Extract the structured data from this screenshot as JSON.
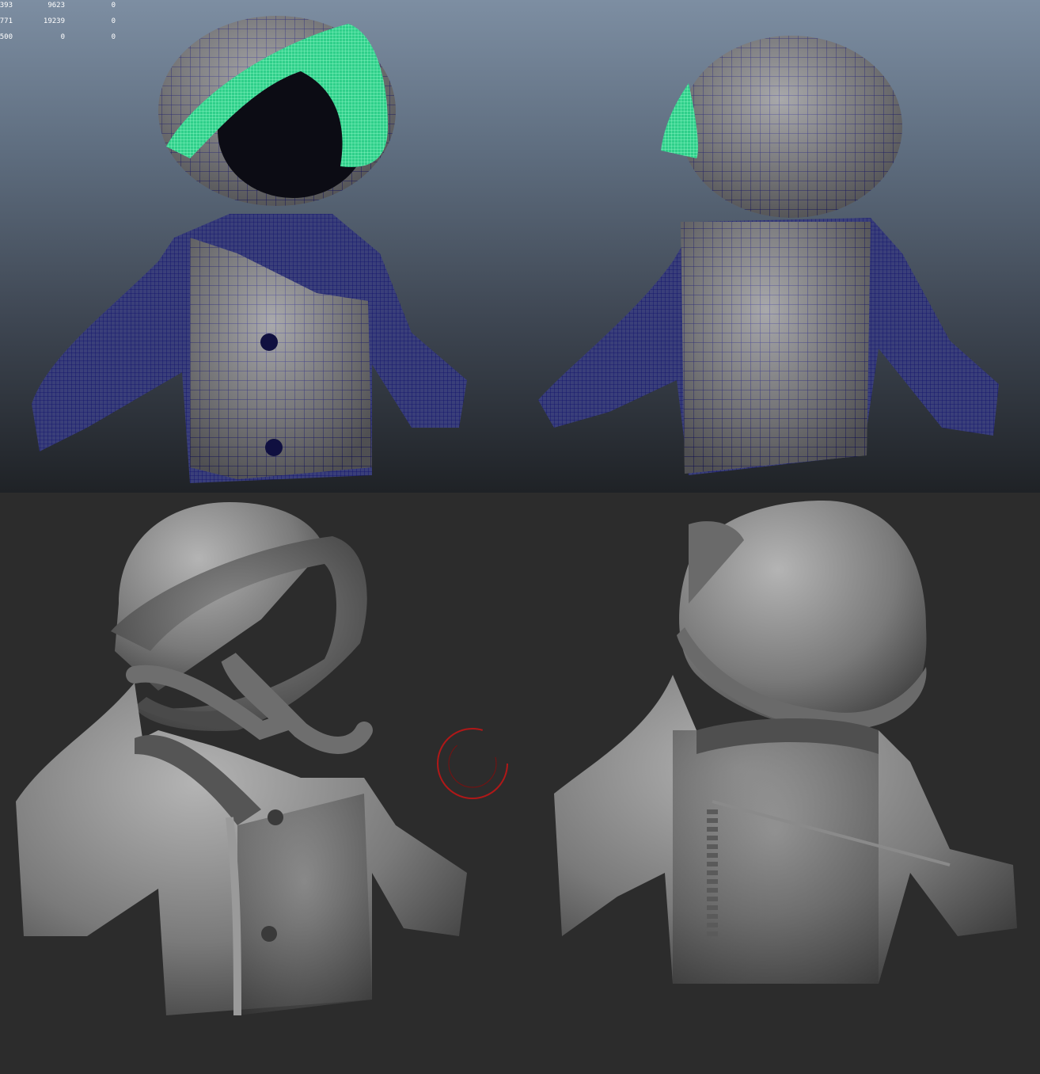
{
  "hud": {
    "rows": [
      {
        "a": "393",
        "b": "9623",
        "c": "0"
      },
      {
        "a": "771",
        "b": "19239",
        "c": "0"
      },
      {
        "a": "500",
        "b": "0",
        "c": "0"
      }
    ]
  },
  "colors": {
    "wire": "#1a1a8a",
    "selection": "#4dffb0",
    "clay": "#6e6e6e",
    "brush_cursor": "#b01818"
  },
  "icons": {
    "brush": "circle-brush-cursor-icon"
  }
}
